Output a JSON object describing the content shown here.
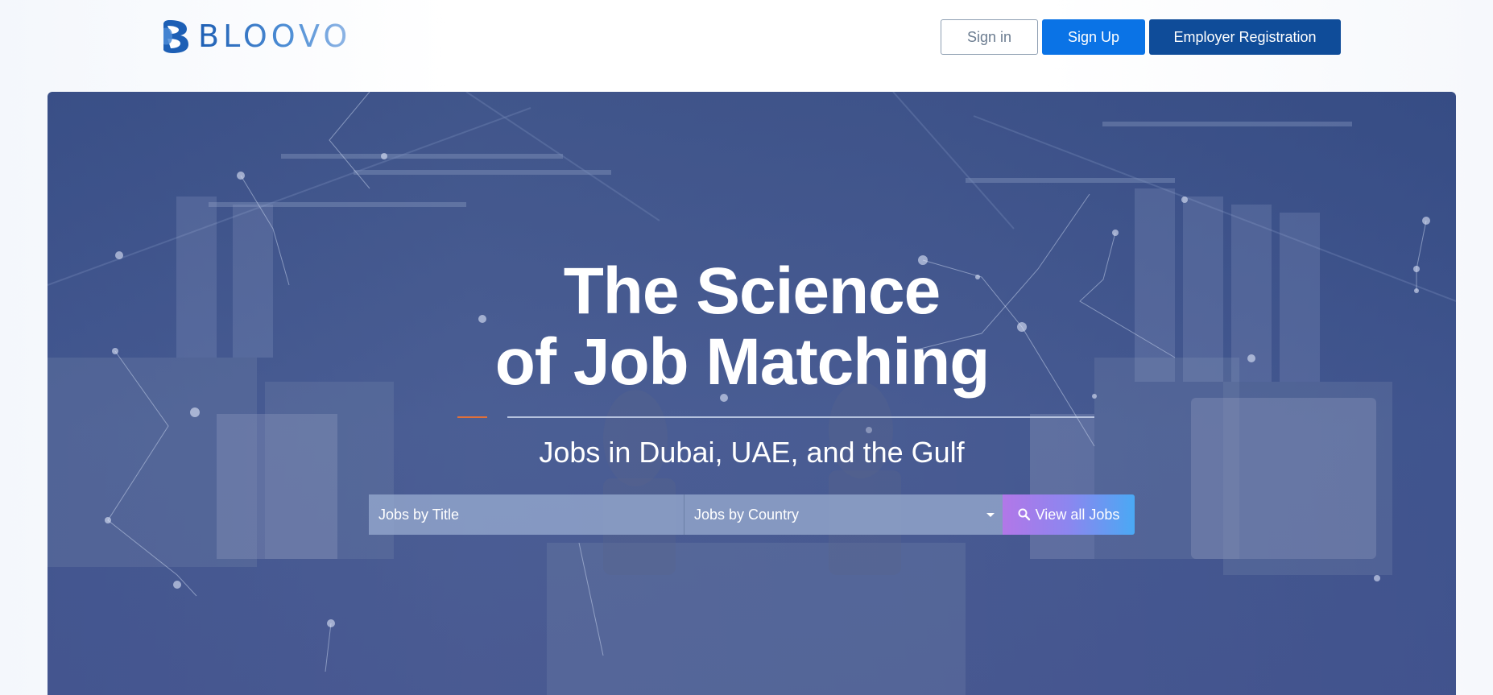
{
  "header": {
    "logo_text": "BLOOVO",
    "signin_label": "Sign in",
    "signup_label": "Sign Up",
    "employer_label": "Employer Registration"
  },
  "hero": {
    "headline_line1": "The Science",
    "headline_line2": "of Job Matching",
    "subheadline": "Jobs in Dubai, UAE, and the Gulf",
    "search": {
      "title_placeholder": "Jobs by Title",
      "country_placeholder": "Jobs by Country",
      "button_label": "View all Jobs"
    }
  },
  "colors": {
    "brand_blue": "#0a73e6",
    "brand_navy": "#0f4c99",
    "accent_orange": "#e0703a",
    "button_gradient_start": "#b277e8",
    "button_gradient_end": "#4aa9f4"
  },
  "icons": {
    "search": "search-icon",
    "dropdown": "chevron-down-icon"
  }
}
